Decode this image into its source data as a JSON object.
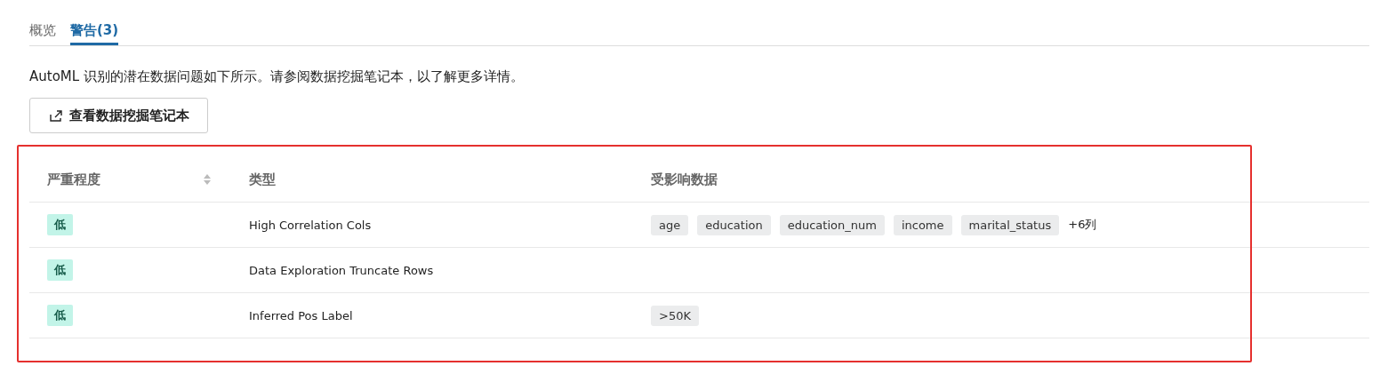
{
  "tabs": [
    {
      "label": "概览",
      "selected": false
    },
    {
      "label": "警告(3)",
      "selected": true
    }
  ],
  "description": "AutoML 识别的潜在数据问题如下所示。请参阅数据挖掘笔记本，以了解更多详情。",
  "button": "查看数据挖掘笔记本",
  "table": {
    "columns": [
      "严重程度",
      "类型",
      "受影响数据"
    ],
    "rows": [
      {
        "severity": "低",
        "type": "High Correlation Cols",
        "affected": [
          "age",
          "education",
          "education_num",
          "income",
          "marital_status"
        ],
        "more": "+6列"
      },
      {
        "severity": "低",
        "type": "Data Exploration Truncate Rows",
        "affected": []
      },
      {
        "severity": "低",
        "type": "Inferred Pos Label",
        "affected": [
          ">50K"
        ]
      }
    ]
  }
}
